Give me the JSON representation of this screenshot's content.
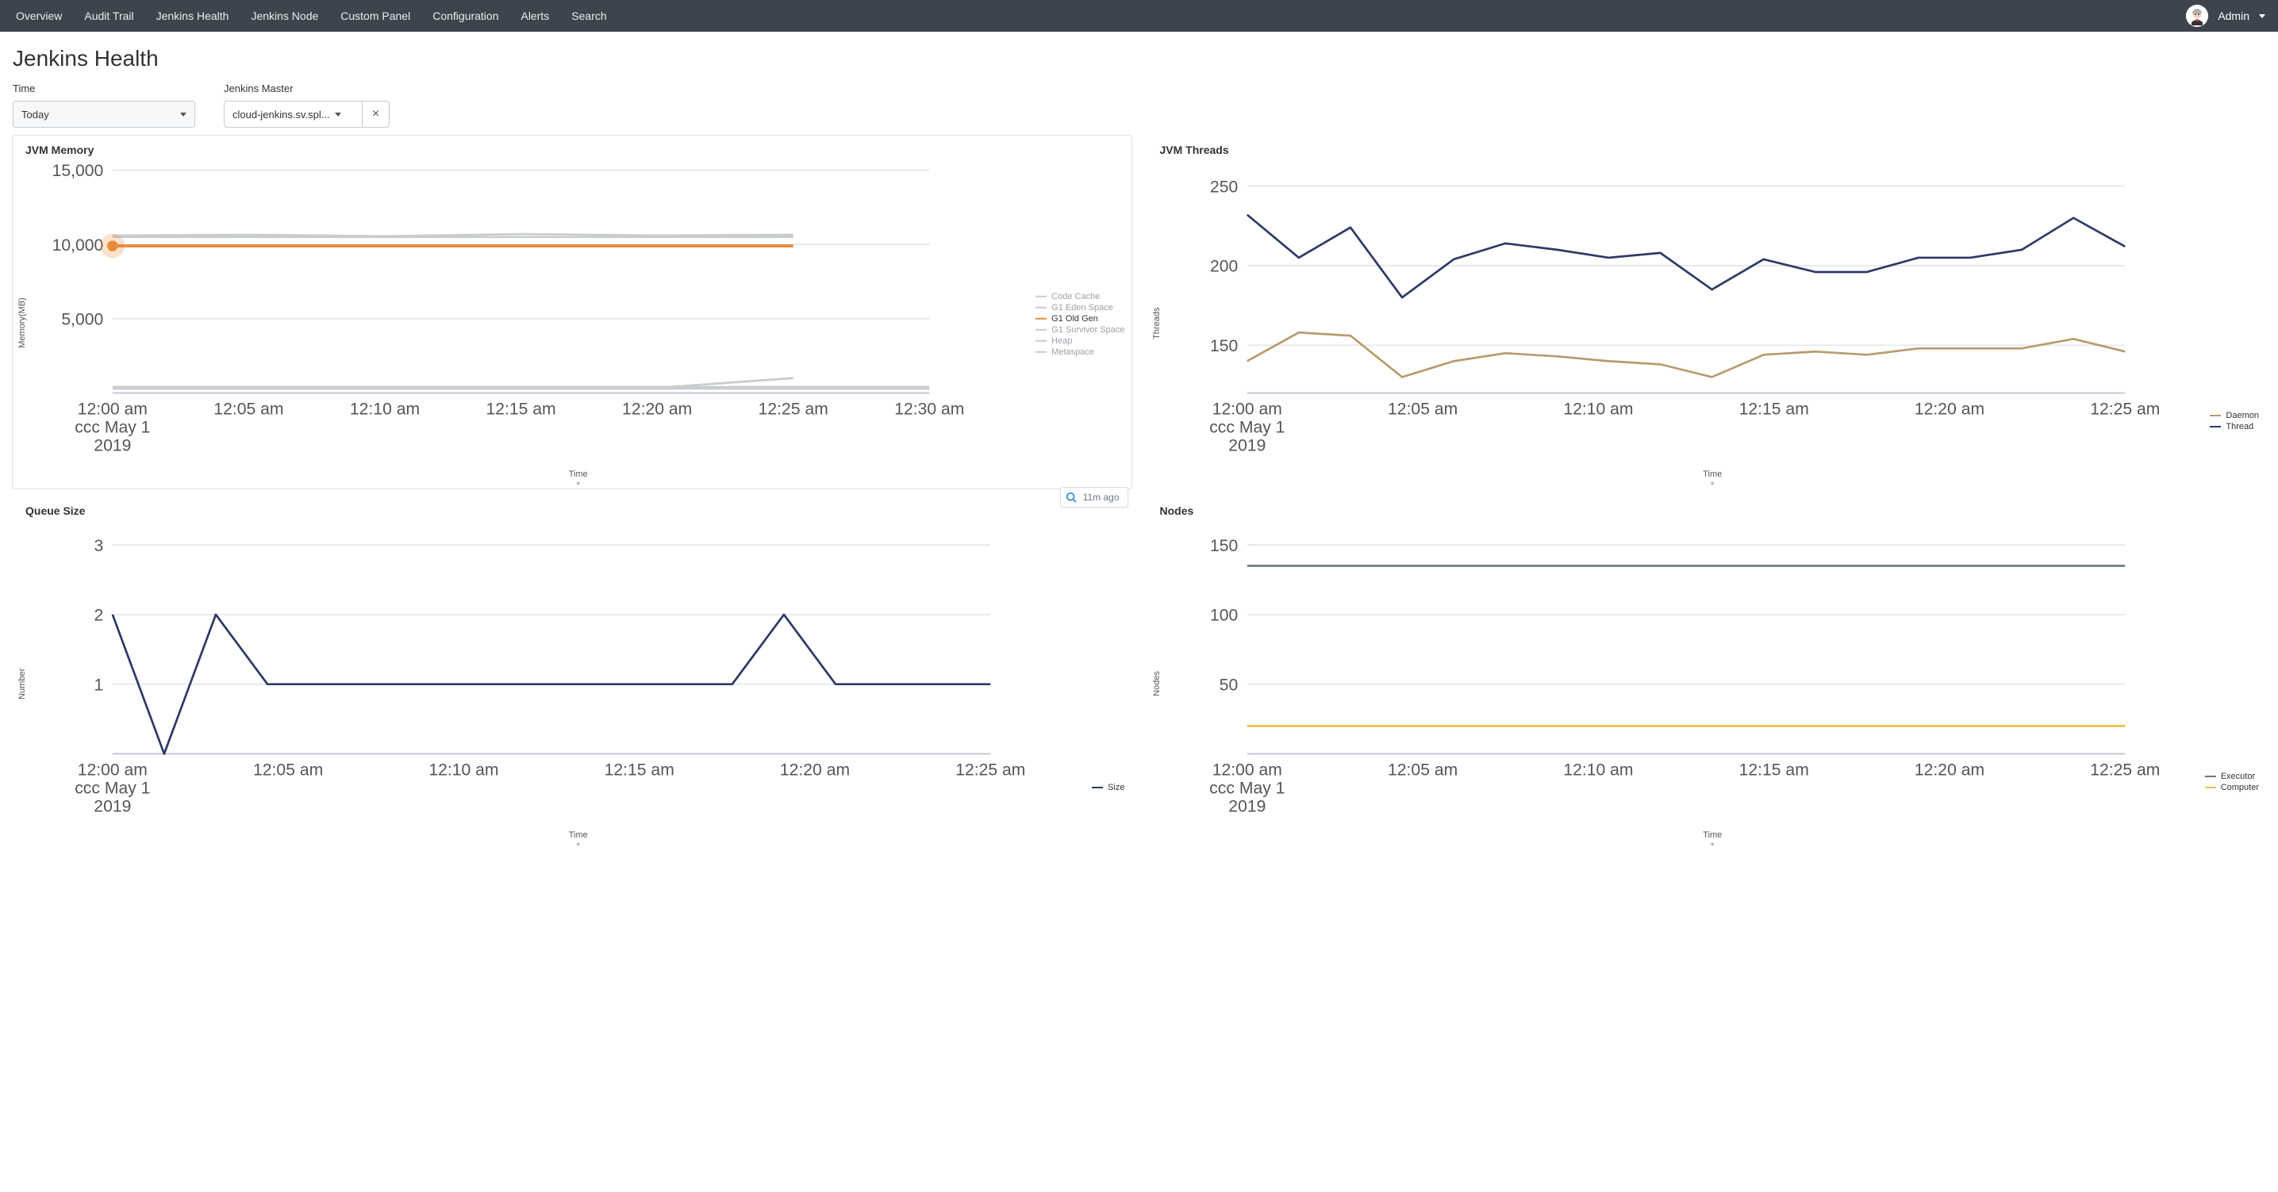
{
  "nav": {
    "items": [
      "Overview",
      "Audit Trail",
      "Jenkins Health",
      "Jenkins Node",
      "Custom Panel",
      "Configuration",
      "Alerts",
      "Search"
    ],
    "user_label": "Admin"
  },
  "page": {
    "title": "Jenkins Health",
    "filters": {
      "time_label": "Time",
      "time_value": "Today",
      "master_label": "Jenkins Master",
      "master_value": "cloud-jenkins.sv.spl...",
      "clear_glyph": "×"
    },
    "refresh_badge": "11m ago"
  },
  "chart_data": [
    {
      "id": "jvm_memory",
      "title": "JVM Memory",
      "type": "line",
      "xlabel": "Time",
      "ylabel": "Memory(MB)",
      "ylim": [
        0,
        15000
      ],
      "y_ticks": [
        5000,
        10000,
        15000
      ],
      "y_tick_labels": [
        "5,000",
        "10,000",
        "15,000"
      ],
      "categories": [
        "12:00 am",
        "12:05 am",
        "12:10 am",
        "12:15 am",
        "12:20 am",
        "12:25 am",
        "12:30 am"
      ],
      "x_tick_extra": {
        "0": [
          "ccc May 1",
          "2019"
        ]
      },
      "legend": [
        "Code Cache",
        "G1 Eden Space",
        "G1 Old Gen",
        "G1 Survivor Space",
        "Heap",
        "Metaspace"
      ],
      "legend_colors": [
        "#c9ccce",
        "#c9ccce",
        "#e98b3a",
        "#c9ccce",
        "#c9ccce",
        "#c9ccce"
      ],
      "highlight_series": "G1 Old Gen",
      "series": [
        {
          "name": "Code Cache",
          "color": "#c9ccce",
          "values": [
            300,
            300,
            300,
            300,
            300,
            300,
            300
          ]
        },
        {
          "name": "G1 Eden Space",
          "color": "#c9ccce",
          "values": [
            10600,
            10650,
            10550,
            10700,
            10600,
            10650,
            null
          ]
        },
        {
          "name": "G1 Old Gen",
          "color": "#e98b3a",
          "values": [
            9900,
            9900,
            9900,
            9900,
            9900,
            9900,
            null
          ]
        },
        {
          "name": "G1 Survivor Space",
          "color": "#c9ccce",
          "values": [
            350,
            350,
            350,
            350,
            350,
            1000,
            null
          ]
        },
        {
          "name": "Heap",
          "color": "#c9ccce",
          "values": [
            10500,
            10500,
            10500,
            10500,
            10500,
            10500,
            null
          ]
        },
        {
          "name": "Metaspace",
          "color": "#c9ccce",
          "values": [
            400,
            400,
            400,
            400,
            400,
            400,
            400
          ]
        }
      ],
      "marker": {
        "x_index": 0,
        "y": 9900,
        "color": "#e98b3a"
      }
    },
    {
      "id": "jvm_threads",
      "title": "JVM Threads",
      "type": "line",
      "xlabel": "Time",
      "ylabel": "Threads",
      "ylim": [
        120,
        260
      ],
      "y_ticks": [
        150,
        200,
        250
      ],
      "y_tick_labels": [
        "150",
        "200",
        "250"
      ],
      "categories": [
        "12:00 am",
        "12:05 am",
        "12:10 am",
        "12:15 am",
        "12:20 am",
        "12:25 am"
      ],
      "x_tick_extra": {
        "0": [
          "ccc May 1",
          "2019"
        ]
      },
      "legend": [
        "Daemon",
        "Thread"
      ],
      "legend_colors": [
        "#b79b6e",
        "#2d3a66"
      ],
      "series": [
        {
          "name": "Daemon",
          "color": "#b79b6e",
          "values": [
            140,
            158,
            156,
            130,
            140,
            145,
            143,
            140,
            138,
            130,
            144,
            146,
            144,
            148,
            148,
            148,
            154,
            146
          ]
        },
        {
          "name": "Thread",
          "color": "#2d3a66",
          "values": [
            232,
            205,
            224,
            180,
            204,
            214,
            210,
            205,
            208,
            185,
            204,
            196,
            196,
            205,
            205,
            210,
            230,
            212
          ]
        }
      ]
    },
    {
      "id": "queue_size",
      "title": "Queue Size",
      "type": "line",
      "xlabel": "Time",
      "ylabel": "Number",
      "ylim": [
        0,
        3.2
      ],
      "y_ticks": [
        1,
        2,
        3
      ],
      "y_tick_labels": [
        "1",
        "2",
        "3"
      ],
      "categories": [
        "12:00 am",
        "12:05 am",
        "12:10 am",
        "12:15 am",
        "12:20 am",
        "12:25 am"
      ],
      "x_tick_extra": {
        "0": [
          "ccc May 1",
          "2019"
        ]
      },
      "legend": [
        "Size"
      ],
      "legend_colors": [
        "#2d3a66"
      ],
      "series": [
        {
          "name": "Size",
          "color": "#2d3a66",
          "values": [
            2,
            0,
            2,
            1,
            1,
            1,
            1,
            1,
            1,
            1,
            1,
            1,
            1,
            2,
            1,
            1,
            1,
            1
          ]
        }
      ]
    },
    {
      "id": "nodes",
      "title": "Nodes",
      "type": "line",
      "xlabel": "Time",
      "ylabel": "Nodes",
      "ylim": [
        0,
        160
      ],
      "y_ticks": [
        50,
        100,
        150
      ],
      "y_tick_labels": [
        "50",
        "100",
        "150"
      ],
      "categories": [
        "12:00 am",
        "12:05 am",
        "12:10 am",
        "12:15 am",
        "12:20 am",
        "12:25 am"
      ],
      "x_tick_extra": {
        "0": [
          "ccc May 1",
          "2019"
        ]
      },
      "legend": [
        "Executor",
        "Computer"
      ],
      "legend_colors": [
        "#6b7785",
        "#f0c04c"
      ],
      "series": [
        {
          "name": "Executor",
          "color": "#6b7785",
          "values": [
            135,
            135,
            135,
            135,
            135,
            135,
            135,
            135,
            135,
            135,
            135,
            135,
            135,
            135,
            135,
            135,
            135,
            135
          ]
        },
        {
          "name": "Computer",
          "color": "#f0c04c",
          "values": [
            20,
            20,
            20,
            20,
            20,
            20,
            20,
            20,
            20,
            20,
            20,
            20,
            20,
            20,
            20,
            20,
            20,
            20
          ]
        }
      ]
    }
  ]
}
